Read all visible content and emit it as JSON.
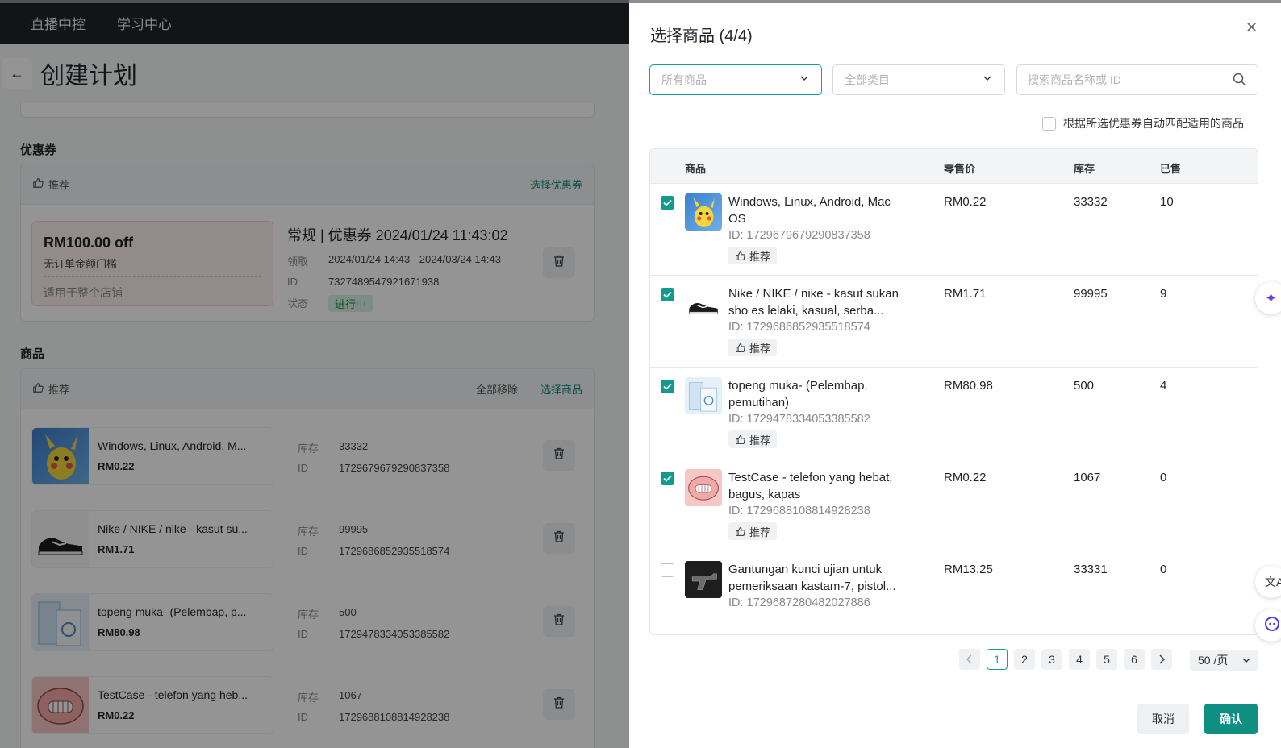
{
  "topnav": {
    "item1": "直播中控",
    "item2": "学习中心"
  },
  "page": {
    "title": "创建计划"
  },
  "coupon_section": {
    "label": "优惠券",
    "recommend": "推荐",
    "select_link": "选择优惠券",
    "coupon": {
      "amount": "RM100.00 off",
      "threshold": "无订单金额门槛",
      "scope": "适用于整个店铺",
      "title": "常规 | 优惠券 2024/01/24 11:43:02",
      "claim_label": "领取",
      "claim_value": "2024/01/24 14:43 - 2024/03/24 14:43",
      "id_label": "ID",
      "id_value": "7327489547921671938",
      "status_label": "状态",
      "status_value": "进行中"
    }
  },
  "product_section": {
    "label": "商品",
    "recommend": "推荐",
    "remove_all": "全部移除",
    "select_link": "选择商品",
    "stock_label": "库存",
    "id_label": "ID",
    "items": [
      {
        "name": "Windows, Linux, Android, M...",
        "price": "RM0.22",
        "stock": "33332",
        "id": "1729679679290837358"
      },
      {
        "name": "Nike / NIKE / nike - kasut su...",
        "price": "RM1.71",
        "stock": "99995",
        "id": "1729686852935518574"
      },
      {
        "name": "topeng muka- (Pelembap, p...",
        "price": "RM80.98",
        "stock": "500",
        "id": "1729478334053385582"
      },
      {
        "name": "TestCase - telefon yang heb...",
        "price": "RM0.22",
        "stock": "1067",
        "id": "1729688108814928238"
      }
    ]
  },
  "drawer": {
    "title": "选择商品 (4/4)",
    "filter_all_products": "所有商品",
    "filter_all_categories": "全部类目",
    "search_placeholder": "搜索商品名称或 ID",
    "auto_match_label": "根据所选优惠券自动匹配适用的商品",
    "columns": {
      "product": "商品",
      "price": "零售价",
      "stock": "库存",
      "sold": "已售"
    },
    "recommend": "推荐",
    "rows": [
      {
        "name_line1": "Windows, Linux, Android, Mac",
        "name_line2": "OS",
        "id": "ID: 1729679679290837358",
        "price": "RM0.22",
        "stock": "33332",
        "sold": "10",
        "checked": true
      },
      {
        "name_line1": "Nike / NIKE / nike - kasut sukan",
        "name_line2": "sho es lelaki, kasual, serba...",
        "id": "ID: 1729686852935518574",
        "price": "RM1.71",
        "stock": "99995",
        "sold": "9",
        "checked": true
      },
      {
        "name_line1": "topeng muka- (Pelembap,",
        "name_line2": "pemutihan)",
        "id": "ID: 1729478334053385582",
        "price": "RM80.98",
        "stock": "500",
        "sold": "4",
        "checked": true
      },
      {
        "name_line1": "TestCase - telefon yang hebat,",
        "name_line2": "bagus, kapas",
        "id": "ID: 1729688108814928238",
        "price": "RM0.22",
        "stock": "1067",
        "sold": "0",
        "checked": true
      },
      {
        "name_line1": "Gantungan kunci ujian untuk",
        "name_line2": "pemeriksaan kastam-7, pistol...",
        "id": "ID: 1729687280482027886",
        "price": "RM13.25",
        "stock": "33331",
        "sold": "0",
        "checked": false
      }
    ],
    "pagination": {
      "pages": [
        "1",
        "2",
        "3",
        "4",
        "5",
        "6"
      ],
      "current": "1",
      "page_size": "50 /页"
    },
    "cancel_label": "取消",
    "confirm_label": "确认"
  },
  "colors": {
    "accent": "#0f9b8e",
    "topbar": "#1f2329",
    "status_green": "#0d8a4f"
  }
}
